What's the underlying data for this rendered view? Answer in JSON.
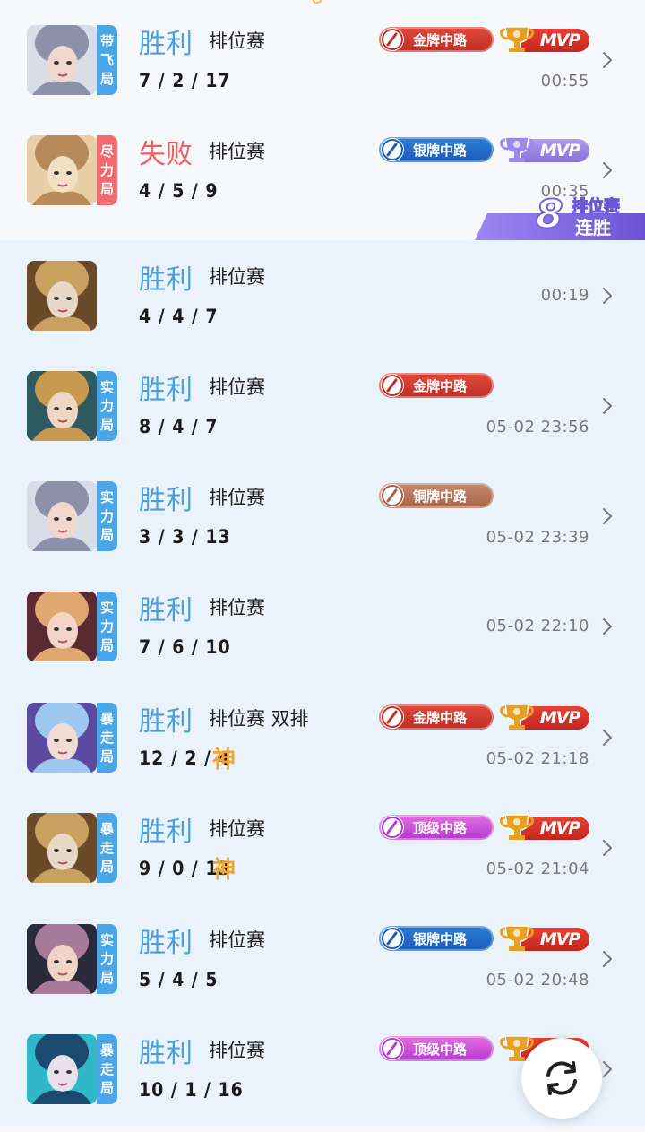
{
  "colors": {
    "win": "#4a9fe0",
    "lose": "#f06060",
    "tag_blue": "#4aa6e6",
    "tag_red": "#f06a70",
    "god_text": "#f4a428",
    "streak": "#7864e0"
  },
  "streak": {
    "count": "8",
    "line1": "排位赛",
    "line2": "连胜"
  },
  "matches": [
    {
      "tag": [
        "带",
        "飞",
        "局"
      ],
      "tag_color": "blue",
      "result": "胜利",
      "lose": false,
      "mode": "排位赛",
      "kda": "7 / 2 / 17",
      "god": "",
      "time": "00:55",
      "badge": "金牌中路",
      "badge_type": "gold",
      "mvp": "MVP",
      "mvp_type": "red"
    },
    {
      "tag": [
        "尽",
        "力",
        "局"
      ],
      "tag_color": "red",
      "result": "失败",
      "lose": true,
      "mode": "排位赛",
      "kda": "4 / 5 / 9",
      "god": "",
      "time": "00:35",
      "badge": "银牌中路",
      "badge_type": "silver",
      "mvp": "MVP",
      "mvp_type": "purple"
    },
    {
      "tag": [],
      "tag_color": "",
      "result": "胜利",
      "lose": false,
      "mode": "排位赛",
      "kda": "4 / 4 / 7",
      "god": "",
      "time": "00:19",
      "badge": "",
      "badge_type": "",
      "mvp": "",
      "mvp_type": ""
    },
    {
      "tag": [
        "实",
        "力",
        "局"
      ],
      "tag_color": "blue",
      "result": "胜利",
      "lose": false,
      "mode": "排位赛",
      "kda": "8 / 4 / 7",
      "god": "",
      "time": "05-02 23:56",
      "badge": "金牌中路",
      "badge_type": "gold",
      "mvp": "",
      "mvp_type": ""
    },
    {
      "tag": [
        "实",
        "力",
        "局"
      ],
      "tag_color": "blue",
      "result": "胜利",
      "lose": false,
      "mode": "排位赛",
      "kda": "3 / 3 / 13",
      "god": "",
      "time": "05-02 23:39",
      "badge": "铜牌中路",
      "badge_type": "bronze",
      "mvp": "",
      "mvp_type": ""
    },
    {
      "tag": [
        "实",
        "力",
        "局"
      ],
      "tag_color": "blue",
      "result": "胜利",
      "lose": false,
      "mode": "排位赛",
      "kda": "7 / 6 / 10",
      "god": "",
      "time": "05-02 22:10",
      "badge": "",
      "badge_type": "",
      "mvp": "",
      "mvp_type": ""
    },
    {
      "tag": [
        "暴",
        "走",
        "局"
      ],
      "tag_color": "blue",
      "result": "胜利",
      "lose": false,
      "mode": "排位赛 双排",
      "kda": "12 / 2 / 4",
      "god": "神",
      "time": "05-02 21:18",
      "badge": "金牌中路",
      "badge_type": "gold",
      "mvp": "MVP",
      "mvp_type": "red"
    },
    {
      "tag": [
        "暴",
        "走",
        "局"
      ],
      "tag_color": "blue",
      "result": "胜利",
      "lose": false,
      "mode": "排位赛",
      "kda": "9 / 0 / 13",
      "god": "神",
      "time": "05-02 21:04",
      "badge": "顶级中路",
      "badge_type": "top",
      "mvp": "MVP",
      "mvp_type": "red"
    },
    {
      "tag": [
        "实",
        "力",
        "局"
      ],
      "tag_color": "blue",
      "result": "胜利",
      "lose": false,
      "mode": "排位赛",
      "kda": "5 / 4 / 5",
      "god": "",
      "time": "05-02 20:48",
      "badge": "银牌中路",
      "badge_type": "silver",
      "mvp": "MVP",
      "mvp_type": "red"
    },
    {
      "tag": [
        "暴",
        "走",
        "局"
      ],
      "tag_color": "blue",
      "result": "胜利",
      "lose": false,
      "mode": "排位赛",
      "kda": "10 / 1 / 16",
      "god": "",
      "time": "05-0",
      "badge": "顶级中路",
      "badge_type": "top",
      "mvp": "MVP",
      "mvp_type": "red"
    }
  ],
  "portraits": [
    "silver-hair-heroine",
    "bald-monk-hero",
    "armored-knight-hero",
    "teal-crown-heroine",
    "silver-hair-heroine",
    "ornate-headdress-heroine",
    "purple-hair-swordsman",
    "armored-knight-hero",
    "dark-hair-heroine",
    "cyan-hair-heroine"
  ],
  "icons": {
    "chevron": "chevron-right-icon",
    "refresh": "refresh-icon",
    "badge": "pencil-badge-icon",
    "trophy": "trophy-icon"
  }
}
